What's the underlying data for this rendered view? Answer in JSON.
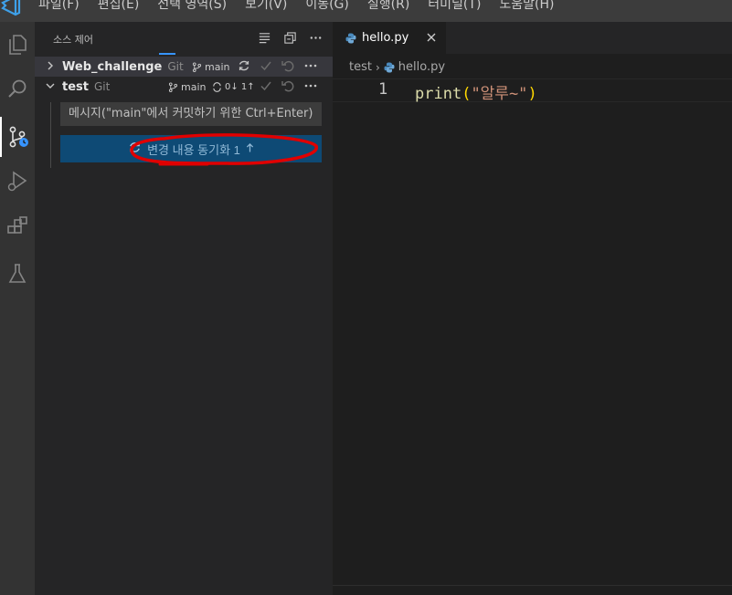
{
  "menubar": {
    "logo": "vscode-logo-icon",
    "items": [
      "파일(F)",
      "편집(E)",
      "선택 영역(S)",
      "보기(V)",
      "이동(G)",
      "실행(R)",
      "터미널(T)",
      "도움말(H)"
    ]
  },
  "activity": {
    "icons": [
      "files-icon",
      "search-icon",
      "source-control-icon",
      "run-debug-icon",
      "extensions-icon",
      "testing-icon"
    ]
  },
  "sidebar": {
    "title": "소스 제어",
    "actions": [
      "list-view-icon",
      "collapse-icon",
      "more-icon"
    ],
    "repos": [
      {
        "name": "Web_challenge",
        "kind": "Git",
        "branch": "main",
        "sync": ""
      },
      {
        "name": "test",
        "kind": "Git",
        "branch": "main",
        "sync": "0↓ 1↑"
      }
    ],
    "commit_placeholder": "메시지(\"main\"에서 커밋하기 위한 Ctrl+Enter)",
    "sync_button": "변경 내용 동기화 1"
  },
  "editor": {
    "tab_label": "hello.py",
    "breadcrumb_folder": "test",
    "breadcrumb_file": "hello.py",
    "line_number": "1",
    "code": {
      "fn": "print",
      "open_paren": "(",
      "string": "\"알루~\"",
      "close_paren": ")"
    }
  },
  "colors": {
    "accent": "#3794ff",
    "sync_button_bg": "#0e4a75",
    "annotation": "#e00000"
  }
}
